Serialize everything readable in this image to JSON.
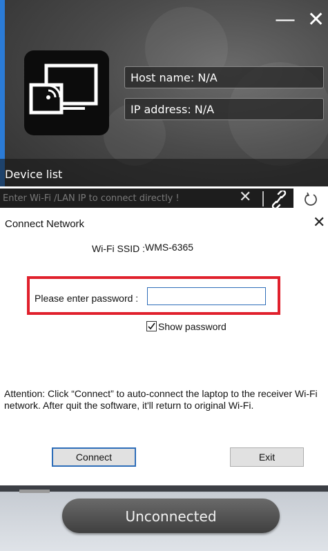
{
  "header": {
    "minimize_glyph": "—",
    "close_glyph": "✕",
    "host_name": "Host name: N/A",
    "ip_address": "IP address: N/A",
    "device_list_label": "Device list",
    "direct_connect_placeholder": "Enter Wi-Fi /LAN IP to connect directly !",
    "clear_glyph": "✕",
    "icons": [
      "cast-screen-icon",
      "link-icon",
      "refresh-icon"
    ]
  },
  "dialog": {
    "title": "Connect Network",
    "close_glyph": "✕",
    "ssid_label": "Wi-Fi SSID :",
    "ssid_value": "WMS-6365",
    "password_label": "Please enter password :",
    "password_value": "",
    "show_password_label": "Show password",
    "show_password_checked": true,
    "attention_text": "Attention: Click “Connect” to auto-connect the laptop to the receiver Wi-Fi network. After quit the software, it'll return to original Wi-Fi.",
    "connect_label": "Connect",
    "exit_label": "Exit",
    "highlight_color": "#e0202c"
  },
  "footer": {
    "status_label": "Unconnected"
  }
}
